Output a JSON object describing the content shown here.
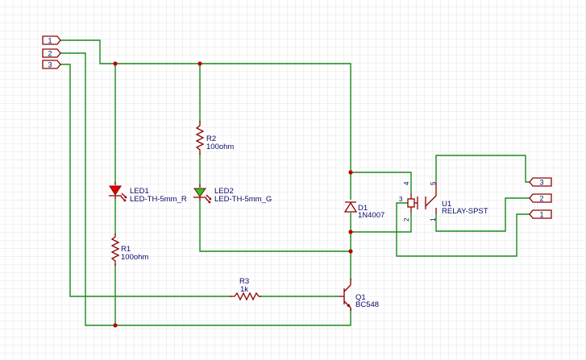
{
  "ports": {
    "left": [
      "1",
      "2",
      "3"
    ],
    "right": [
      "3",
      "2",
      "1"
    ]
  },
  "components": {
    "led1": {
      "ref": "LED1",
      "value": "LED-TH-5mm_R"
    },
    "led2": {
      "ref": "LED2",
      "value": "LED-TH-5mm_G"
    },
    "r1": {
      "ref": "R1",
      "value": "100ohm"
    },
    "r2": {
      "ref": "R2",
      "value": "100ohm"
    },
    "r3": {
      "ref": "R3",
      "value": "1k"
    },
    "d1": {
      "ref": "D1",
      "value": "1N4007"
    },
    "q1": {
      "ref": "Q1",
      "value": "BC548"
    },
    "u1": {
      "ref": "U1",
      "value": "RELAY-SPST",
      "pins": [
        "4",
        "3",
        "2",
        "5",
        "1"
      ]
    }
  },
  "colors": {
    "wire": "#1a8a1a",
    "part": "#8b0000",
    "label": "#0a0a6a",
    "junction": "#c00000",
    "led_red": "#e00000",
    "led_green": "#22cc22",
    "grid": "#e6e6e6"
  }
}
